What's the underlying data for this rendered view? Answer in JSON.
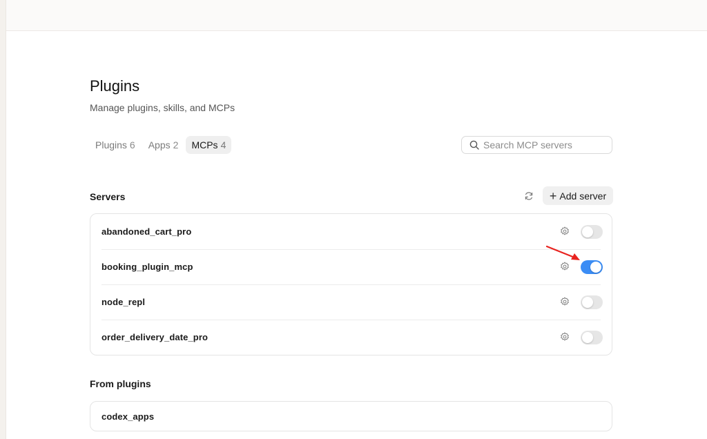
{
  "header": {
    "title": "Plugins",
    "subtitle": "Manage plugins, skills, and MCPs"
  },
  "tabs": [
    {
      "label": "Plugins",
      "count": "6",
      "active": false
    },
    {
      "label": "Apps",
      "count": "2",
      "active": false
    },
    {
      "label": "MCPs",
      "count": "4",
      "active": true
    }
  ],
  "search": {
    "placeholder": "Search MCP servers",
    "value": ""
  },
  "servers": {
    "title": "Servers",
    "add_label": "Add server",
    "items": [
      {
        "name": "abandoned_cart_pro",
        "enabled": false
      },
      {
        "name": "booking_plugin_mcp",
        "enabled": true
      },
      {
        "name": "node_repl",
        "enabled": false
      },
      {
        "name": "order_delivery_date_pro",
        "enabled": false
      }
    ]
  },
  "from_plugins": {
    "title": "From plugins",
    "items": [
      {
        "name": "codex_apps"
      }
    ]
  },
  "colors": {
    "accent": "#3b8df5",
    "annotation_arrow": "#e8231f"
  },
  "icons": [
    "search-icon",
    "refresh-icon",
    "plus-icon",
    "gear-icon",
    "annotation-arrow-icon"
  ]
}
